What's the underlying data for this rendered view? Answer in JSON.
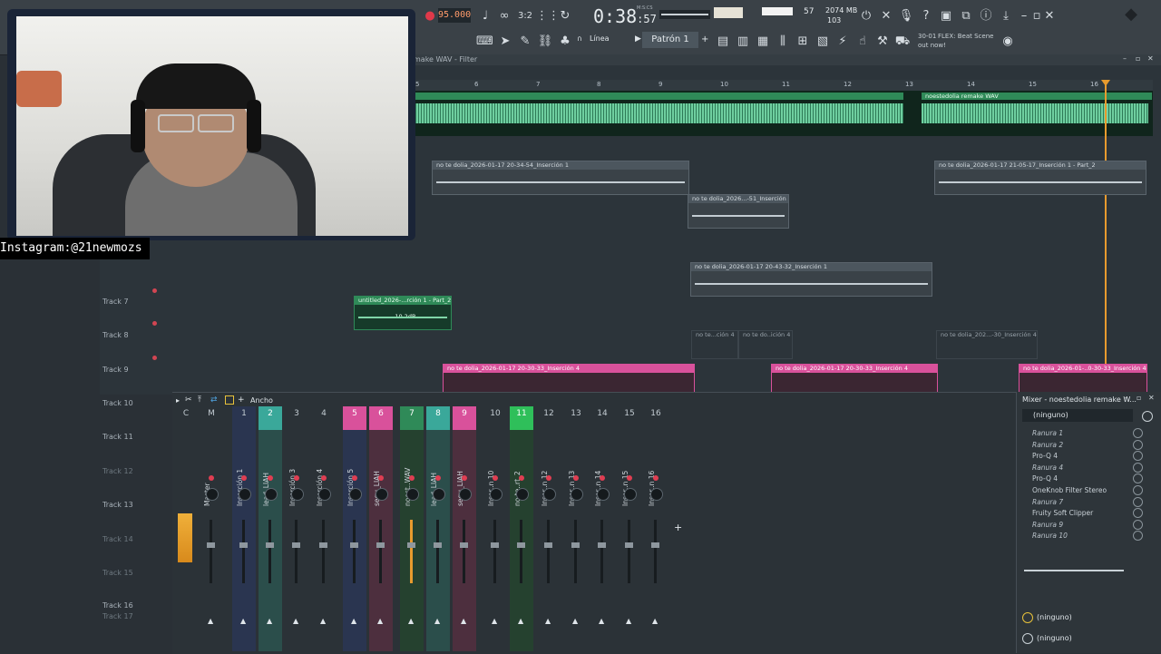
{
  "toolbar": {
    "tempo": "95.000",
    "time_main": "0:38",
    "time_sub": ":57",
    "time_label": "M:S:CS",
    "cpu_value": "57",
    "memory": "2074 MB",
    "polyphony": "103",
    "line_mode": "Línea",
    "pattern": "Patrón 1",
    "news_date": "30-01",
    "news_text": "FLEX: Beat Scene",
    "news_text2": "out now!"
  },
  "webcam": {
    "overlay": "Instagram:@21newmozs"
  },
  "playlist": {
    "title": "make WAV - Filter",
    "bar_numbers": [
      "5",
      "6",
      "7",
      "8",
      "9",
      "10",
      "11",
      "12",
      "13",
      "14",
      "15",
      "16"
    ],
    "tracks": [
      "Track 7",
      "Track 8",
      "Track 9",
      "Track 10",
      "Track 11",
      "Track 12",
      "Track 13",
      "Track 14",
      "Track 15",
      "Track 16",
      "Track 17"
    ],
    "clips": {
      "top_audio": "noestedolia remake WAV",
      "c1": "no te dolia_2026-01-17 20-34-54_Inserción 1",
      "c2": "no te dolia_2026-01-17 21-05-17_Inserción 1 - Part_2",
      "c3": "no te dolia_2026...-51_Inserción 1",
      "c4": "no te dolia_2026-01-17 20-43-32_Inserción 1",
      "c5": "untitled_2026-...rción 1 - Part_2",
      "c5_db": "-10.2dB",
      "c6": "no te...ción 4",
      "c7": "no te do..ición 4",
      "c8": "no te dolia_202...-30_Inserción 4",
      "c9": "no te dolia_2026-01-17 20-30-33_Inserción 4",
      "c10": "no te dolia_2026-01-17 20-30-33_Inserción 4",
      "c11": "no te dolia_2026-01-..0-30-33_Inserción 4"
    }
  },
  "mixer": {
    "width_label": "Ancho",
    "panel_title": "Mixer - noestedolia remake W...",
    "preset": "(ninguno)",
    "strips": [
      {
        "num": "C",
        "name": ""
      },
      {
        "num": "M",
        "name": "Master"
      },
      {
        "num": "1",
        "name": "Inserción 1"
      },
      {
        "num": "2",
        "name": "lead_LIAH"
      },
      {
        "num": "3",
        "name": "Inserción 3"
      },
      {
        "num": "4",
        "name": "Inserción 4"
      },
      {
        "num": "5",
        "name": "Inserción 5"
      },
      {
        "num": "6",
        "name": "segu_LIAH"
      },
      {
        "num": "7",
        "name": "noest..WAV"
      },
      {
        "num": "8",
        "name": "lead_LIAH"
      },
      {
        "num": "9",
        "name": "segu_LIAH"
      },
      {
        "num": "10",
        "name": "Inser..n 10"
      },
      {
        "num": "11",
        "name": "no te..rt_2"
      },
      {
        "num": "12",
        "name": "Inser..n 12"
      },
      {
        "num": "13",
        "name": "Inser..n 13"
      },
      {
        "num": "14",
        "name": "Inser..n 14"
      },
      {
        "num": "15",
        "name": "Inser..n 15"
      },
      {
        "num": "16",
        "name": "Inser..n 16"
      }
    ],
    "slots": [
      "Ranura 1",
      "Ranura 2",
      "Pro-Q 4",
      "Ranura 4",
      "Pro-Q 4",
      "OneKnob Filter Stereo",
      "Ranura 7",
      "Fruity Soft Clipper",
      "Ranura 9",
      "Ranura 10"
    ],
    "bottom_preset_1": "(ninguno)",
    "bottom_preset_2": "(ninguno)"
  },
  "colors": {
    "accent_green": "#2f8a58",
    "accent_pink": "#d9519b",
    "accent_teal": "#3aa89a",
    "playhead": "#e89b2e"
  }
}
